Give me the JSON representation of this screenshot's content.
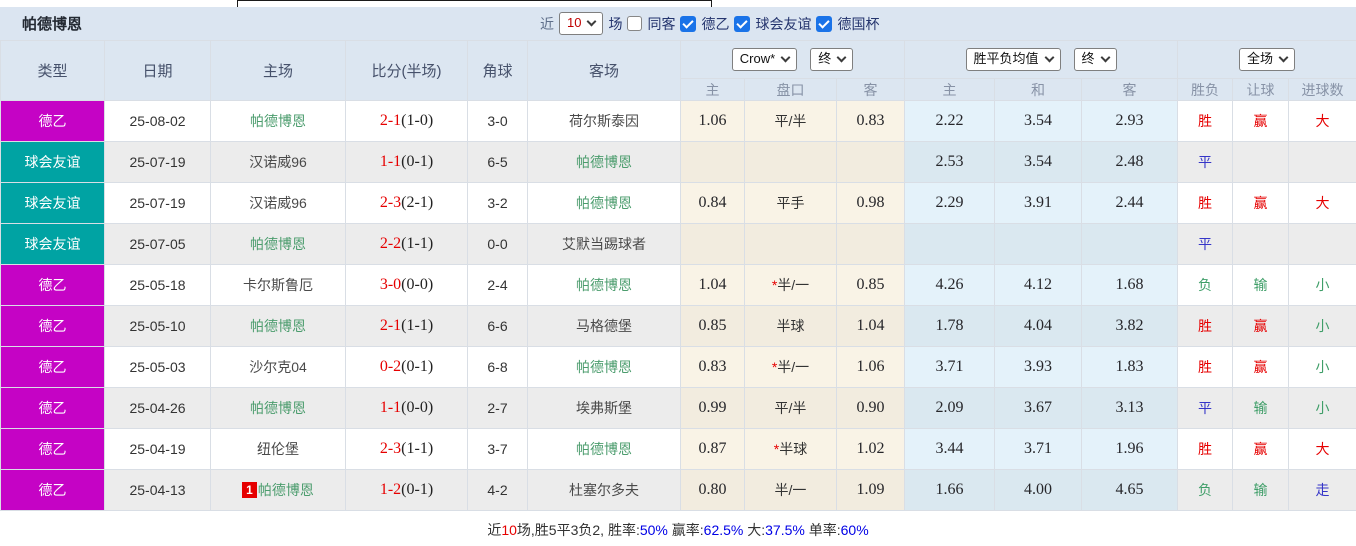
{
  "title": "帕德博恩",
  "filter": {
    "near_label": "近",
    "near_count": "10",
    "games_label": "场",
    "same_away": {
      "label": "同客",
      "checked": false
    },
    "leagues": [
      {
        "label": "德乙",
        "checked": true
      },
      {
        "label": "球会友谊",
        "checked": true
      },
      {
        "label": "德国杯",
        "checked": true
      }
    ]
  },
  "selects": {
    "crow": "Crow*",
    "final1": "终",
    "avg": "胜平负均值",
    "final2": "终",
    "scope": "全场"
  },
  "columns": {
    "type": "类型",
    "date": "日期",
    "home": "主场",
    "score": "比分(半场)",
    "corner": "角球",
    "away": "客场",
    "odds_home": "主",
    "handicap": "盘口",
    "odds_away": "客",
    "avg_home": "主",
    "avg_draw": "和",
    "avg_away": "客",
    "result": "胜负",
    "goal_line": "让球",
    "goals": "进球数"
  },
  "colors": {
    "league_de2": "#c503c5",
    "league_friendly": "#00a3a3",
    "win_red": "#e60000",
    "draw_blue": "#3535c8",
    "lose_green": "#3f9e68",
    "team_self_green": "#4b9c6d",
    "header_bg": "#dce6f1",
    "checkbox_blue": "#1a73e8"
  },
  "value_colors": {
    "胜": "#e60000",
    "平": "#3535c8",
    "负": "#3f9e68",
    "赢": "#e60000",
    "输": "#3f9e68",
    "走": "#3535c8",
    "大": "#e60000",
    "小": "#3f9e68"
  },
  "table": {
    "rows": [
      {
        "type": "德乙",
        "type_color": "#c503c5",
        "date": "25-08-02",
        "home": {
          "name": "帕德博恩",
          "self": true,
          "badge": ""
        },
        "score": {
          "ft": "2-1",
          "ht": "(1-0)"
        },
        "corner": "3-0",
        "away": {
          "name": "荷尔斯泰因",
          "self": false,
          "badge": ""
        },
        "odds": {
          "home": "1.06",
          "star": "",
          "line": "平/半",
          "away": "0.83"
        },
        "avg": {
          "home": "2.22",
          "draw": "3.54",
          "away": "2.93"
        },
        "result": "胜",
        "goal_line": "赢",
        "goals": "大"
      },
      {
        "type": "球会友谊",
        "type_color": "#00a3a3",
        "date": "25-07-19",
        "home": {
          "name": "汉诺威96",
          "self": false,
          "badge": ""
        },
        "score": {
          "ft": "1-1",
          "ht": "(0-1)"
        },
        "corner": "6-5",
        "away": {
          "name": "帕德博恩",
          "self": true,
          "badge": ""
        },
        "odds": {
          "home": "",
          "star": "",
          "line": "",
          "away": ""
        },
        "avg": {
          "home": "2.53",
          "draw": "3.54",
          "away": "2.48"
        },
        "result": "平",
        "goal_line": "",
        "goals": ""
      },
      {
        "type": "球会友谊",
        "type_color": "#00a3a3",
        "date": "25-07-19",
        "home": {
          "name": "汉诺威96",
          "self": false,
          "badge": ""
        },
        "score": {
          "ft": "2-3",
          "ht": "(2-1)"
        },
        "corner": "3-2",
        "away": {
          "name": "帕德博恩",
          "self": true,
          "badge": ""
        },
        "odds": {
          "home": "0.84",
          "star": "",
          "line": "平手",
          "away": "0.98"
        },
        "avg": {
          "home": "2.29",
          "draw": "3.91",
          "away": "2.44"
        },
        "result": "胜",
        "goal_line": "赢",
        "goals": "大"
      },
      {
        "type": "球会友谊",
        "type_color": "#00a3a3",
        "date": "25-07-05",
        "home": {
          "name": "帕德博恩",
          "self": true,
          "badge": ""
        },
        "score": {
          "ft": "2-2",
          "ht": "(1-1)"
        },
        "corner": "0-0",
        "away": {
          "name": "艾默当踢球者",
          "self": false,
          "badge": ""
        },
        "odds": {
          "home": "",
          "star": "",
          "line": "",
          "away": ""
        },
        "avg": {
          "home": "",
          "draw": "",
          "away": ""
        },
        "result": "平",
        "goal_line": "",
        "goals": ""
      },
      {
        "type": "德乙",
        "type_color": "#c503c5",
        "date": "25-05-18",
        "home": {
          "name": "卡尔斯鲁厄",
          "self": false,
          "badge": ""
        },
        "score": {
          "ft": "3-0",
          "ht": "(0-0)"
        },
        "corner": "2-4",
        "away": {
          "name": "帕德博恩",
          "self": true,
          "badge": ""
        },
        "odds": {
          "home": "1.04",
          "star": "*",
          "line": "半/一",
          "away": "0.85"
        },
        "avg": {
          "home": "4.26",
          "draw": "4.12",
          "away": "1.68"
        },
        "result": "负",
        "goal_line": "输",
        "goals": "小"
      },
      {
        "type": "德乙",
        "type_color": "#c503c5",
        "date": "25-05-10",
        "home": {
          "name": "帕德博恩",
          "self": true,
          "badge": ""
        },
        "score": {
          "ft": "2-1",
          "ht": "(1-1)"
        },
        "corner": "6-6",
        "away": {
          "name": "马格德堡",
          "self": false,
          "badge": ""
        },
        "odds": {
          "home": "0.85",
          "star": "",
          "line": "半球",
          "away": "1.04"
        },
        "avg": {
          "home": "1.78",
          "draw": "4.04",
          "away": "3.82"
        },
        "result": "胜",
        "goal_line": "赢",
        "goals": "小"
      },
      {
        "type": "德乙",
        "type_color": "#c503c5",
        "date": "25-05-03",
        "home": {
          "name": "沙尔克04",
          "self": false,
          "badge": ""
        },
        "score": {
          "ft": "0-2",
          "ht": "(0-1)"
        },
        "corner": "6-8",
        "away": {
          "name": "帕德博恩",
          "self": true,
          "badge": ""
        },
        "odds": {
          "home": "0.83",
          "star": "*",
          "line": "半/一",
          "away": "1.06"
        },
        "avg": {
          "home": "3.71",
          "draw": "3.93",
          "away": "1.83"
        },
        "result": "胜",
        "goal_line": "赢",
        "goals": "小"
      },
      {
        "type": "德乙",
        "type_color": "#c503c5",
        "date": "25-04-26",
        "home": {
          "name": "帕德博恩",
          "self": true,
          "badge": ""
        },
        "score": {
          "ft": "1-1",
          "ht": "(0-0)"
        },
        "corner": "2-7",
        "away": {
          "name": "埃弗斯堡",
          "self": false,
          "badge": ""
        },
        "odds": {
          "home": "0.99",
          "star": "",
          "line": "平/半",
          "away": "0.90"
        },
        "avg": {
          "home": "2.09",
          "draw": "3.67",
          "away": "3.13"
        },
        "result": "平",
        "goal_line": "输",
        "goals": "小"
      },
      {
        "type": "德乙",
        "type_color": "#c503c5",
        "date": "25-04-19",
        "home": {
          "name": "纽伦堡",
          "self": false,
          "badge": ""
        },
        "score": {
          "ft": "2-3",
          "ht": "(1-1)"
        },
        "corner": "3-7",
        "away": {
          "name": "帕德博恩",
          "self": true,
          "badge": ""
        },
        "odds": {
          "home": "0.87",
          "star": "*",
          "line": "半球",
          "away": "1.02"
        },
        "avg": {
          "home": "3.44",
          "draw": "3.71",
          "away": "1.96"
        },
        "result": "胜",
        "goal_line": "赢",
        "goals": "大"
      },
      {
        "type": "德乙",
        "type_color": "#c503c5",
        "date": "25-04-13",
        "home": {
          "name": "帕德博恩",
          "self": true,
          "badge": "1"
        },
        "score": {
          "ft": "1-2",
          "ht": "(0-1)"
        },
        "corner": "4-2",
        "away": {
          "name": "杜塞尔多夫",
          "self": false,
          "badge": ""
        },
        "odds": {
          "home": "0.80",
          "star": "",
          "line": "半/一",
          "away": "1.09"
        },
        "avg": {
          "home": "1.66",
          "draw": "4.00",
          "away": "4.65"
        },
        "result": "负",
        "goal_line": "输",
        "goals": "走"
      }
    ]
  },
  "footer": {
    "near": "近",
    "count": "10",
    "mid": "场,胜5平3负2, 胜率:",
    "win_rate": "50%",
    "l2": " 赢率:",
    "v2": "62.5%",
    "l3": " 大:",
    "v3": "37.5%",
    "l4": " 单率:",
    "v4": "60%"
  }
}
